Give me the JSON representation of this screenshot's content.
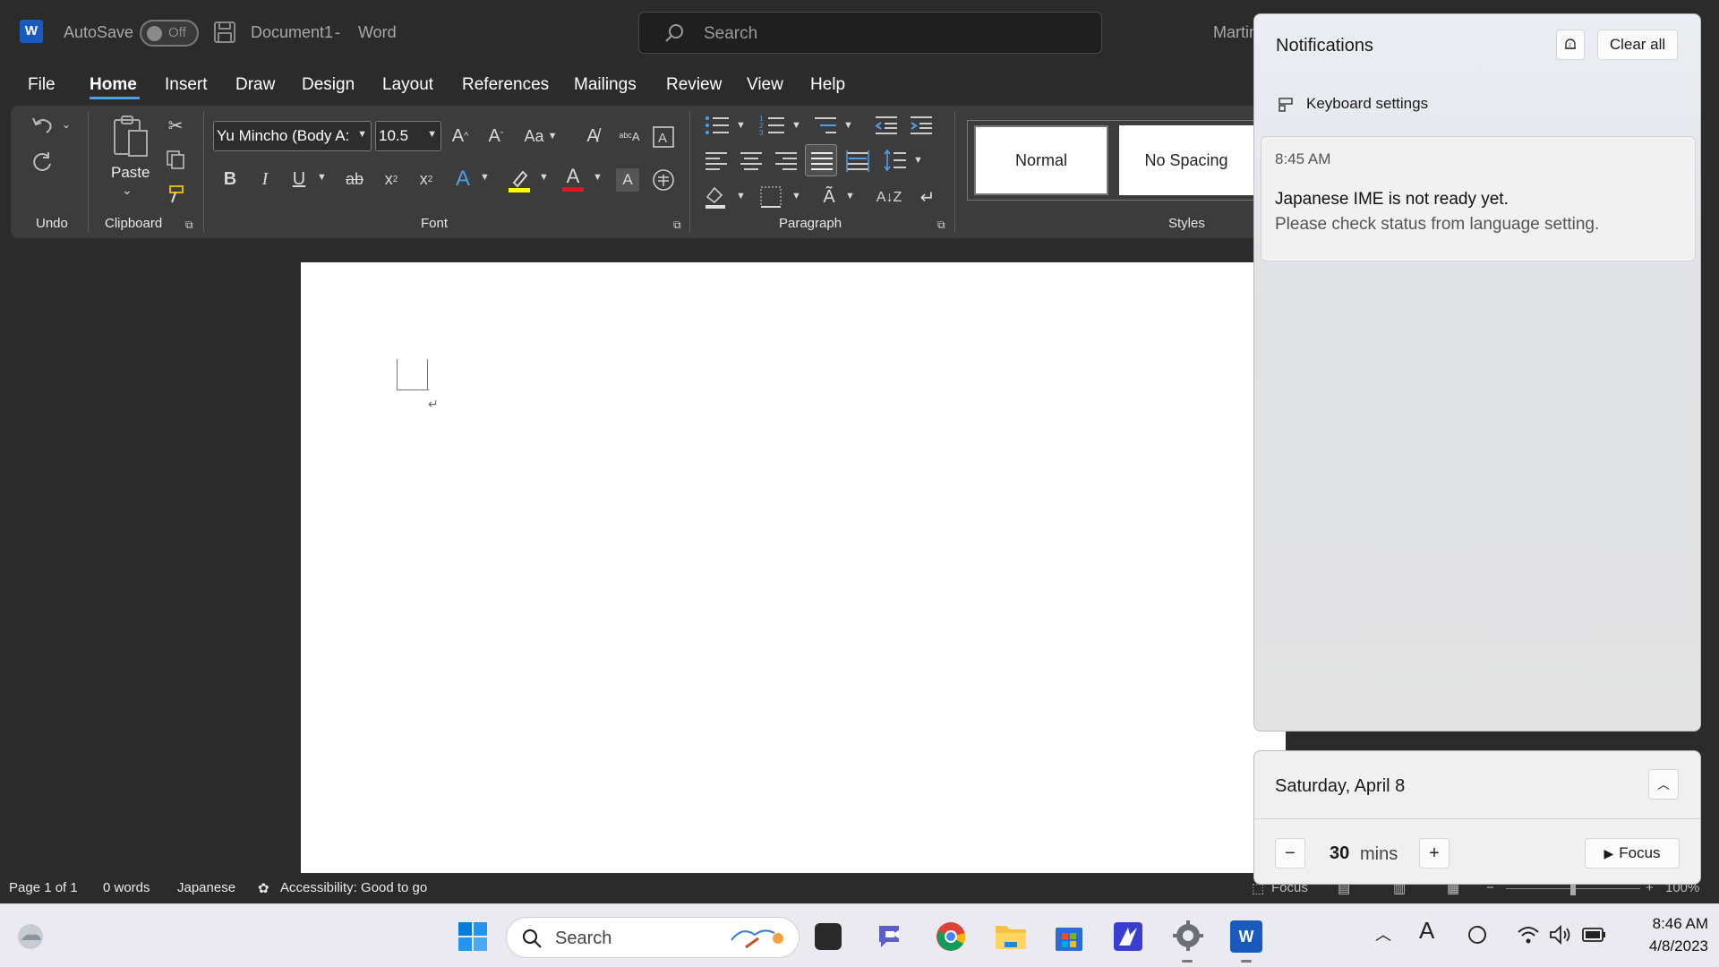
{
  "titlebar": {
    "app_logo": "W",
    "autosave_label": "AutoSave",
    "autosave_state": "Off",
    "document_title": "Document1",
    "separator": "-",
    "app_name": "Word",
    "search_placeholder": "Search",
    "user": "Martin"
  },
  "menu": {
    "tabs": [
      "File",
      "Home",
      "Insert",
      "Draw",
      "Design",
      "Layout",
      "References",
      "Mailings",
      "Review",
      "View",
      "Help"
    ],
    "active": "Home"
  },
  "ribbon": {
    "undo_label": "Undo",
    "clipboard_label": "Clipboard",
    "paste_label": "Paste",
    "font_label": "Font",
    "font_name": "Yu Mincho (Body A:",
    "font_size": "10.5",
    "change_case": "Aa",
    "paragraph_label": "Paragraph",
    "styles_label": "Styles",
    "styles": [
      "Normal",
      "No Spacing"
    ]
  },
  "status": {
    "page": "Page 1 of 1",
    "words": "0 words",
    "language": "Japanese",
    "accessibility": "Accessibility: Good to go",
    "focus": "Focus",
    "zoom": "100%"
  },
  "notifications": {
    "title": "Notifications",
    "clear_all": "Clear all",
    "keyboard_settings": "Keyboard settings",
    "item": {
      "time": "8:45 AM",
      "heading": "Japanese IME is not ready yet.",
      "body": "Please check status from language setting."
    }
  },
  "calendar": {
    "date": "Saturday, April 8",
    "focus_minutes": "30",
    "focus_unit": "mins",
    "focus_button": "Focus"
  },
  "taskbar": {
    "search_placeholder": "Search",
    "time": "8:46 AM",
    "date": "4/8/2023",
    "ime_indicator": "A"
  },
  "colors": {
    "accent": "#4f9ee8",
    "word_blue": "#185abd",
    "highlight": "#ffff00",
    "font_color": "#e81123"
  }
}
